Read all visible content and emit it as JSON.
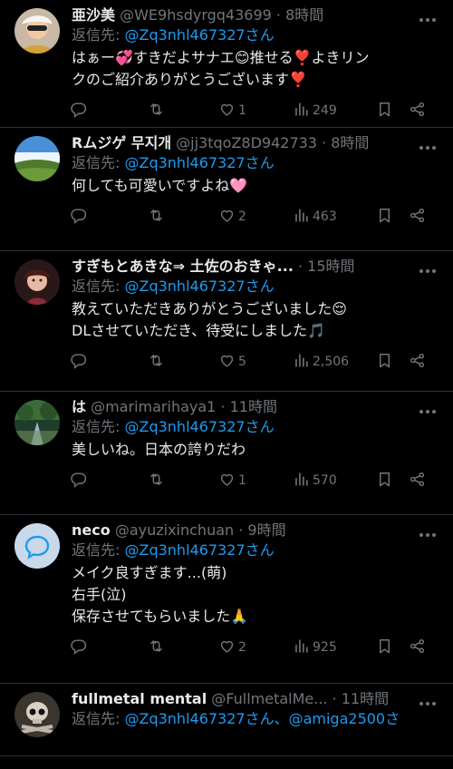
{
  "tweets": [
    {
      "name": "亜沙美",
      "handle": "@WE9hsdyrgq43699",
      "time": "8時間",
      "reply_prefix": "返信先: ",
      "reply_to": "@Zq3nhl467327さん",
      "lines": [
        "はぁー💞すきだよサナエ😊推せる❣️よきリン",
        "クのご紹介ありがとうございます❣️"
      ],
      "replies": "",
      "retweets": "",
      "likes": "1",
      "views": "249"
    },
    {
      "name": "Rムジゲ 무지개",
      "handle": "@jj3tqoZ8D942733",
      "time": "8時間",
      "reply_prefix": "返信先: ",
      "reply_to": "@Zq3nhl467327さん",
      "lines": [
        "何しても可愛いですよね🩷"
      ],
      "replies": "",
      "retweets": "",
      "likes": "2",
      "views": "463"
    },
    {
      "name": "すぎもとあきな⇒ 土佐のおきゃ...",
      "handle": "",
      "time": "15時間",
      "reply_prefix": "返信先: ",
      "reply_to": "@Zq3nhl467327さん",
      "lines": [
        "教えていただきありがとうございました😌",
        "DLさせていただき、待受にしました🎵"
      ],
      "replies": "",
      "retweets": "",
      "likes": "5",
      "views": "2,506"
    },
    {
      "name": "は",
      "handle": "@marimarihaya1",
      "time": "11時間",
      "reply_prefix": "返信先: ",
      "reply_to": "@Zq3nhl467327さん",
      "lines": [
        "美しいね。日本の誇りだわ"
      ],
      "replies": "",
      "retweets": "",
      "likes": "1",
      "views": "570"
    },
    {
      "name": "neco",
      "handle": "@ayuzixinchuan",
      "time": "9時間",
      "reply_prefix": "返信先: ",
      "reply_to": "@Zq3nhl467327さん",
      "lines": [
        "メイク良すぎます...(萌)",
        "右手(泣)",
        "保存させてもらいました🙏"
      ],
      "replies": "",
      "retweets": "",
      "likes": "2",
      "views": "925"
    },
    {
      "name": "fullmetal mental",
      "handle": "@FullmetalMe...",
      "time": "11時間",
      "reply_prefix": "返信先: ",
      "reply_to": "@Zq3nhl467327さん、@amiga2500さ",
      "lines": [],
      "replies": "",
      "retweets": "",
      "likes": "",
      "views": ""
    }
  ],
  "separator": " · ",
  "colors": {
    "background": "#000000",
    "text": "#e7e9ea",
    "muted": "#71767b",
    "link": "#1d9bf0",
    "divider": "#2f3336"
  },
  "icons": [
    "reply-icon",
    "retweet-icon",
    "like-icon",
    "views-icon",
    "bookmark-icon",
    "share-icon",
    "more-icon"
  ]
}
